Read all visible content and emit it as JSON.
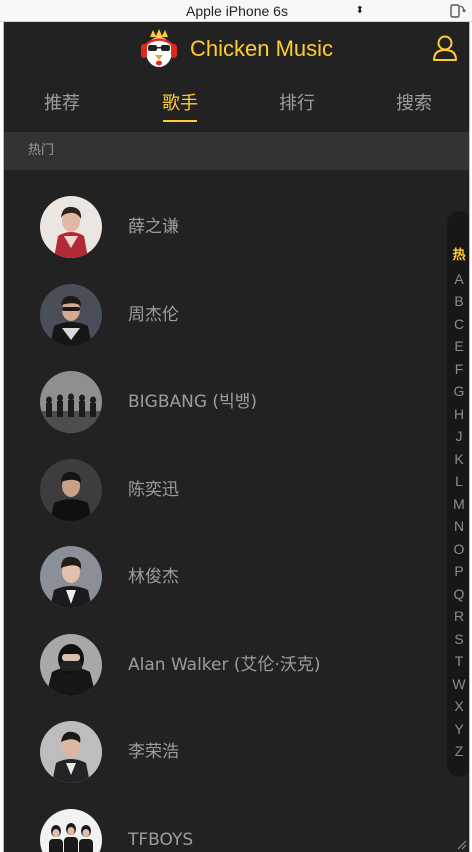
{
  "device_bar": {
    "device_name": "Apple iPhone 6s",
    "arrows": "⬍"
  },
  "header": {
    "title": "Chicken Music",
    "logo_icon": "chicken-logo-icon",
    "user_icon": "user-icon"
  },
  "tabs": [
    {
      "label": "推荐",
      "active": false
    },
    {
      "label": "歌手",
      "active": true
    },
    {
      "label": "排行",
      "active": false
    },
    {
      "label": "搜索",
      "active": false
    }
  ],
  "group": {
    "title": "热门"
  },
  "singers": [
    {
      "name": "薛之谦"
    },
    {
      "name": "周杰伦"
    },
    {
      "name": "BIGBANG (빅뱅)"
    },
    {
      "name": "陈奕迅"
    },
    {
      "name": "林俊杰"
    },
    {
      "name": "Alan Walker (艾伦·沃克)"
    },
    {
      "name": "李荣浩"
    },
    {
      "name": "TFBOYS"
    }
  ],
  "index_bar": {
    "letters": [
      "热",
      "A",
      "B",
      "C",
      "E",
      "F",
      "G",
      "H",
      "J",
      "K",
      "L",
      "M",
      "N",
      "O",
      "P",
      "Q",
      "R",
      "S",
      "T",
      "W",
      "X",
      "Y",
      "Z"
    ],
    "current": "热"
  },
  "colors": {
    "background": "#222222",
    "accent": "#ffcd32",
    "group_bg": "#333333"
  }
}
